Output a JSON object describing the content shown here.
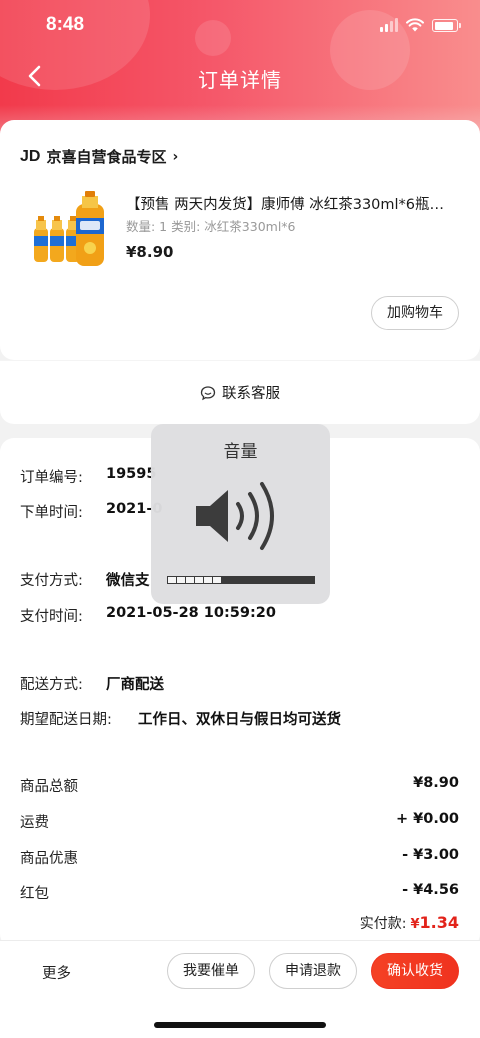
{
  "status_bar": {
    "time": "8:48"
  },
  "nav": {
    "title": "订单详情",
    "back_icon": "chevron-left-icon"
  },
  "store": {
    "logo": "JD",
    "name": "京喜自营食品专区",
    "chevron": "›"
  },
  "product": {
    "title": "【预售 两天内发货】康师傅 冰红茶330ml*6瓶柠檬口味",
    "meta": "数量: 1  类别: 冰红茶330ml*6",
    "price": "¥8.90",
    "cart_button": "加购物车"
  },
  "service": {
    "label": "联系客服",
    "icon": "chat-bubble-icon"
  },
  "order_info": {
    "order_no_label": "订单编号:",
    "order_no_value": "19595",
    "order_time_label": "下单时间:",
    "order_time_value": "2021-0",
    "pay_method_label": "支付方式:",
    "pay_method_value": "微信支",
    "pay_time_label": "支付时间:",
    "pay_time_value": "2021-05-28 10:59:20",
    "delivery_label": "配送方式:",
    "delivery_value": "厂商配送",
    "expected_label": "期望配送日期:",
    "expected_value": "工作日、双休日与假日均可送货"
  },
  "amounts": {
    "subtotal_label": "商品总额",
    "subtotal_value": "¥8.90",
    "shipping_label": "运费",
    "shipping_value": "+ ¥0.00",
    "discount_label": "商品优惠",
    "discount_value": "- ¥3.00",
    "redpacket_label": "红包",
    "redpacket_value": "- ¥4.56",
    "paid_label": "实付款:",
    "paid_currency": "¥",
    "paid_value": "1.34"
  },
  "bottom_bar": {
    "more": "更多",
    "remind": "我要催单",
    "refund": "申请退款",
    "confirm": "确认收货"
  },
  "volume_hud": {
    "title": "音量",
    "icon": "speaker-icon",
    "level": 0.375
  },
  "colors": {
    "header_start": "#f23a4b",
    "header_end": "#f98d8d",
    "price_red": "#e2231a",
    "confirm_button": "#f0331f"
  }
}
